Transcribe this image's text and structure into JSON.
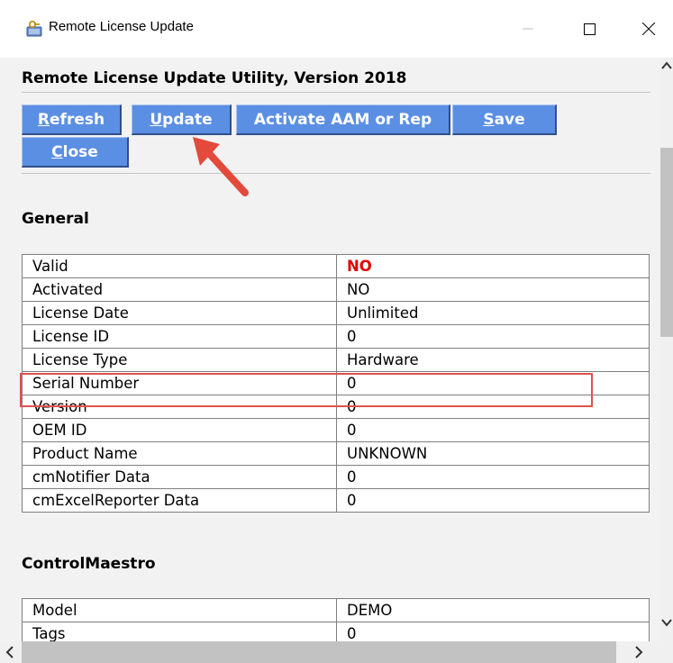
{
  "window": {
    "title": "Remote License Update",
    "icons": {
      "app": "key-folder-icon",
      "minimize": "minimize-icon",
      "maximize": "maximize-icon",
      "close": "close-icon"
    }
  },
  "page": {
    "title": "Remote License Update Utility, Version 2018"
  },
  "toolbar": {
    "refresh_accel": "R",
    "refresh_rest": "efresh",
    "update_accel": "U",
    "update_rest": "pdate",
    "activate_label": "Activate AAM or Rep",
    "save_accel": "S",
    "save_rest": "ave",
    "close_accel": "C",
    "close_rest": "lose"
  },
  "general": {
    "title": "General",
    "rows": [
      {
        "key": "Valid",
        "value": "NO"
      },
      {
        "key": "Activated",
        "value": "NO"
      },
      {
        "key": "License Date",
        "value": "Unlimited"
      },
      {
        "key": "License ID",
        "value": "0"
      },
      {
        "key": "License Type",
        "value": "Hardware"
      },
      {
        "key": "Serial Number",
        "value": "0"
      },
      {
        "key": "Version",
        "value": "0"
      },
      {
        "key": "OEM ID",
        "value": "0"
      },
      {
        "key": "Product Name",
        "value": "UNKNOWN"
      },
      {
        "key": "cmNotifier Data",
        "value": "0"
      },
      {
        "key": "cmExcelReporter Data",
        "value": "0"
      }
    ]
  },
  "controlmaestro": {
    "title": "ControlMaestro",
    "rows": [
      {
        "key": "Model",
        "value": "DEMO"
      },
      {
        "key": "Tags",
        "value": "0"
      }
    ]
  },
  "annotations": {
    "arrow": "red-arrow-icon",
    "highlight_color": "#e0514b"
  },
  "colors": {
    "button_bg": "#5b8fe3",
    "valid_red": "#e00000",
    "content_bg": "#f2f2f2"
  }
}
